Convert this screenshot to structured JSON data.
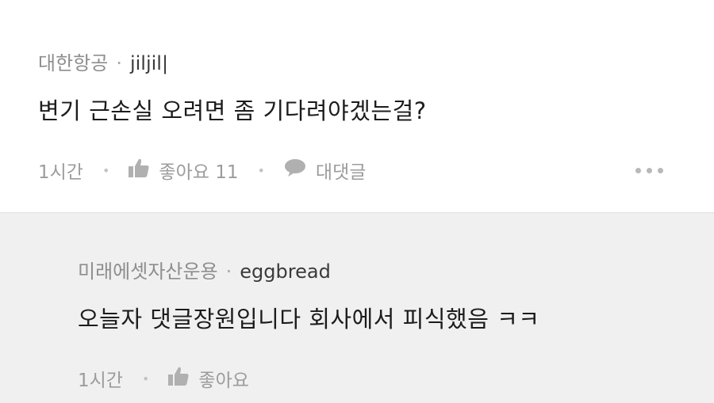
{
  "comment": {
    "company": "대한항공",
    "separator": "·",
    "username": "jiljil|",
    "text": "변기 근손실 오려면 좀 기다려야겠는걸?",
    "time": "1시간",
    "like_label": "좋아요 11",
    "reply_label": "대댓글"
  },
  "reply": {
    "company": "미래에셋자산운용",
    "separator": "·",
    "username": "eggbread",
    "text": "오늘자 댓글장원입니다 회사에서 피식했음 ㅋㅋ",
    "time": "1시간",
    "like_label": "좋아요"
  },
  "icons": {
    "like": "thumbs-up-icon",
    "reply": "speech-bubble-icon",
    "more": "more-dots-icon"
  },
  "colors": {
    "reply_background": "#f0f0f0",
    "meta_text": "#8e8e8e",
    "body_text": "#1c1c1c",
    "icon": "#b0b0b0"
  }
}
